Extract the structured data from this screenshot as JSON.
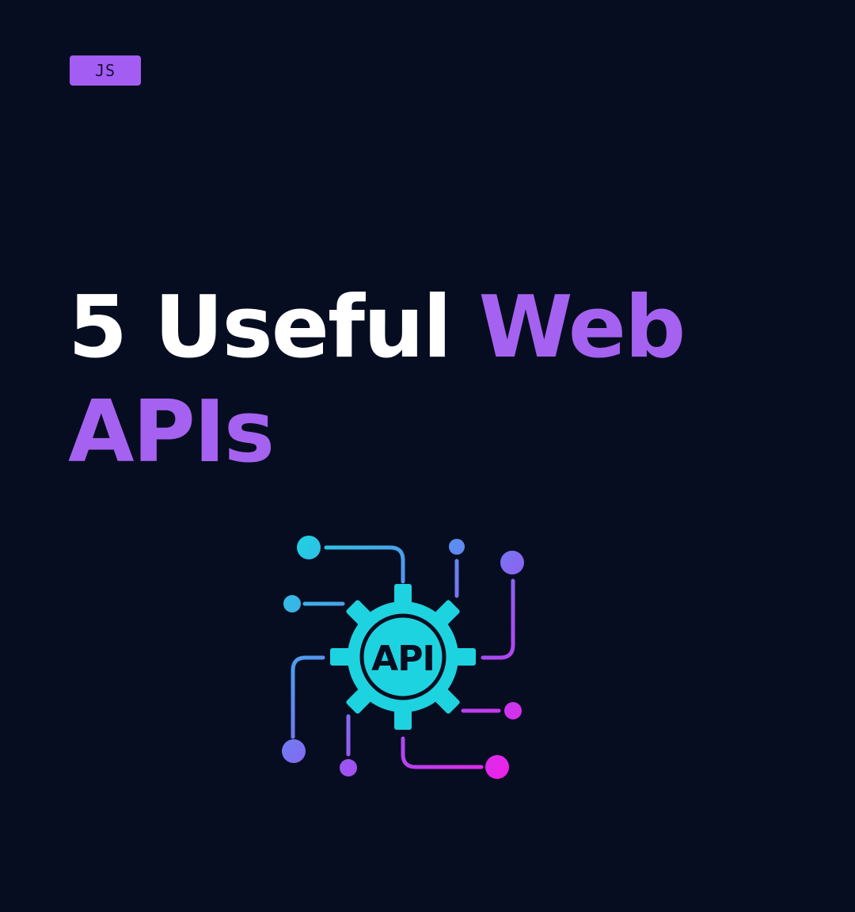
{
  "tag": {
    "label": "JS"
  },
  "headline": {
    "part1": "5 Useful",
    "part2": "Web",
    "part3": "APIs"
  },
  "icon": {
    "name": "api-gear-icon",
    "label": "API"
  },
  "colors": {
    "background": "#070d20",
    "accent": "#a562f0",
    "tag_bg": "#a35df2",
    "text": "#ffffff",
    "gradient_cyan": "#1ed3e0",
    "gradient_blue": "#5b8ef0",
    "gradient_purple": "#a24ff2",
    "gradient_magenta": "#f21ee8"
  }
}
